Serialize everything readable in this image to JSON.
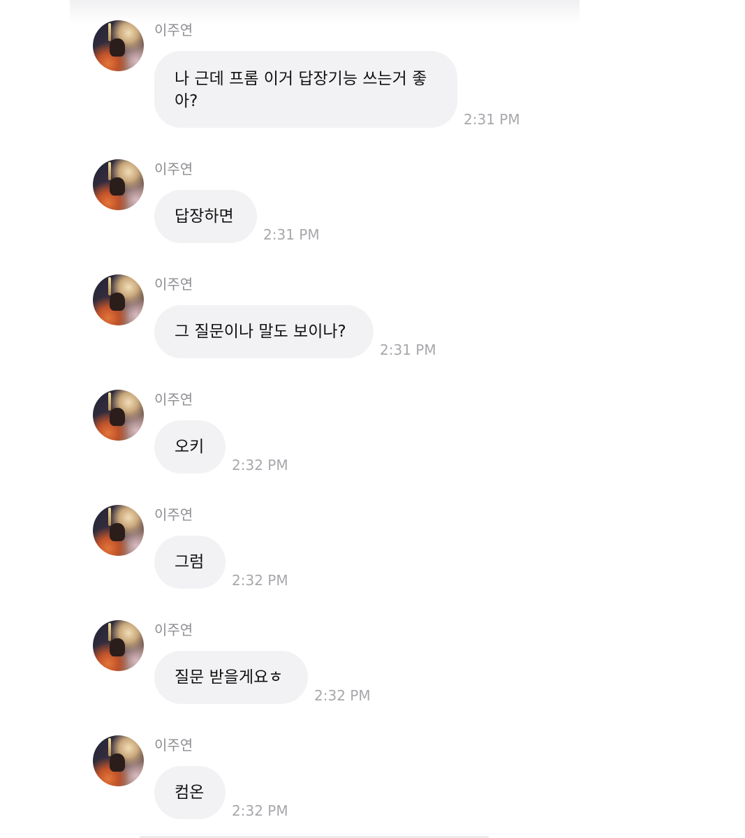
{
  "messages": [
    {
      "sender": "이주연",
      "text": "나 근데 프롬 이거 답장기능 쓰는거 좋아?",
      "time": "2:31 PM"
    },
    {
      "sender": "이주연",
      "text": "답장하면",
      "time": "2:31 PM"
    },
    {
      "sender": "이주연",
      "text": "그 질문이나 말도 보이나?",
      "time": "2:31 PM"
    },
    {
      "sender": "이주연",
      "text": "오키",
      "time": "2:32 PM"
    },
    {
      "sender": "이주연",
      "text": "그럼",
      "time": "2:32 PM"
    },
    {
      "sender": "이주연",
      "text": "질문 받을게요ㅎ",
      "time": "2:32 PM"
    },
    {
      "sender": "이주연",
      "text": "컴온",
      "time": "2:32 PM"
    }
  ]
}
